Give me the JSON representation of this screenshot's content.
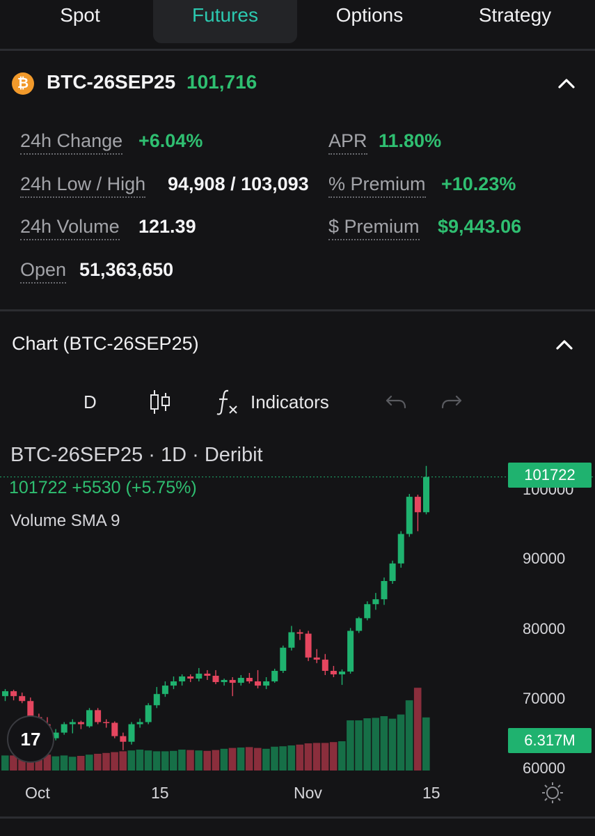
{
  "tabs": [
    {
      "label": "Spot"
    },
    {
      "label": "Futures"
    },
    {
      "label": "Options"
    },
    {
      "label": "Strategy"
    }
  ],
  "instrument": {
    "name": "BTC-26SEP25",
    "price": "101,716",
    "coin_symbol": "₿",
    "stats": {
      "change_label": "24h Change",
      "change_value": "+6.04%",
      "lowhigh_label": "24h Low / High",
      "lowhigh_value": "94,908 / 103,093",
      "volume_label": "24h Volume",
      "volume_value": "121.39",
      "open_label": "Open",
      "open_value": "51,363,650",
      "apr_label": "APR",
      "apr_value": "11.80%",
      "pct_premium_label": "% Premium",
      "pct_premium_value": "+10.23%",
      "usd_premium_label": "$ Premium",
      "usd_premium_value": "$9,443.06"
    }
  },
  "chart_section": {
    "title": "Chart (BTC-26SEP25)",
    "toolbar": {
      "interval": "D",
      "indicators_label": "Indicators"
    },
    "legend_title": "BTC-26SEP25 · 1D · Deribit",
    "legend_values": "101722  +5530 (+5.75%)",
    "legend_volume": "Volume SMA 9",
    "price_tag": "101722",
    "volume_tag": "6.317M",
    "logo_text": "17"
  },
  "colors": {
    "up": "#1fb26f",
    "down": "#e5465f",
    "accent": "#2cc9b0"
  },
  "chart_data": {
    "type": "candlestick",
    "y_ticks": [
      "100000",
      "90000",
      "80000",
      "70000",
      "60000"
    ],
    "x_ticks": [
      "Oct",
      "15",
      "Nov",
      "15"
    ],
    "ylim": [
      59000,
      103500
    ],
    "candles": [
      {
        "o": 70500,
        "h": 71500,
        "l": 69800,
        "c": 71200
      },
      {
        "o": 71200,
        "h": 71400,
        "l": 69900,
        "c": 70500
      },
      {
        "o": 70500,
        "h": 71000,
        "l": 69500,
        "c": 69800
      },
      {
        "o": 69800,
        "h": 70300,
        "l": 67200,
        "c": 67500
      },
      {
        "o": 67500,
        "h": 68000,
        "l": 66200,
        "c": 66500
      },
      {
        "o": 66500,
        "h": 67500,
        "l": 63800,
        "c": 64500
      },
      {
        "o": 64500,
        "h": 65800,
        "l": 64200,
        "c": 65300
      },
      {
        "o": 65300,
        "h": 66800,
        "l": 65000,
        "c": 66500
      },
      {
        "o": 66500,
        "h": 67200,
        "l": 65200,
        "c": 66800
      },
      {
        "o": 66800,
        "h": 67000,
        "l": 65800,
        "c": 66500
      },
      {
        "o": 66200,
        "h": 68800,
        "l": 66000,
        "c": 68500
      },
      {
        "o": 68500,
        "h": 68800,
        "l": 66500,
        "c": 66800
      },
      {
        "o": 66800,
        "h": 67200,
        "l": 66000,
        "c": 66700
      },
      {
        "o": 66700,
        "h": 66900,
        "l": 64500,
        "c": 64800
      },
      {
        "o": 64800,
        "h": 65300,
        "l": 62800,
        "c": 64000
      },
      {
        "o": 64000,
        "h": 66800,
        "l": 63600,
        "c": 66500
      },
      {
        "o": 66500,
        "h": 67300,
        "l": 66000,
        "c": 66800
      },
      {
        "o": 66800,
        "h": 69500,
        "l": 66500,
        "c": 69200
      },
      {
        "o": 69200,
        "h": 71800,
        "l": 68800,
        "c": 70800
      },
      {
        "o": 70800,
        "h": 72600,
        "l": 70400,
        "c": 72000
      },
      {
        "o": 72000,
        "h": 73300,
        "l": 71500,
        "c": 72600
      },
      {
        "o": 72600,
        "h": 73600,
        "l": 72000,
        "c": 73300
      },
      {
        "o": 73300,
        "h": 73600,
        "l": 72500,
        "c": 73000
      },
      {
        "o": 73000,
        "h": 74500,
        "l": 72600,
        "c": 73700
      },
      {
        "o": 73700,
        "h": 74200,
        "l": 72800,
        "c": 73400
      },
      {
        "o": 73400,
        "h": 74200,
        "l": 72200,
        "c": 72500
      },
      {
        "o": 72500,
        "h": 73000,
        "l": 72000,
        "c": 72800
      },
      {
        "o": 72800,
        "h": 73200,
        "l": 70500,
        "c": 72400
      },
      {
        "o": 72400,
        "h": 73500,
        "l": 72000,
        "c": 73100
      },
      {
        "o": 73100,
        "h": 73800,
        "l": 72300,
        "c": 72600
      },
      {
        "o": 72600,
        "h": 74200,
        "l": 71600,
        "c": 72000
      },
      {
        "o": 72000,
        "h": 73200,
        "l": 71500,
        "c": 72600
      },
      {
        "o": 72600,
        "h": 74400,
        "l": 72400,
        "c": 74100
      },
      {
        "o": 74100,
        "h": 77700,
        "l": 73800,
        "c": 77400
      },
      {
        "o": 77400,
        "h": 80500,
        "l": 77000,
        "c": 79600
      },
      {
        "o": 79600,
        "h": 80000,
        "l": 78500,
        "c": 79400
      },
      {
        "o": 79400,
        "h": 79800,
        "l": 75500,
        "c": 76000
      },
      {
        "o": 76000,
        "h": 77200,
        "l": 75200,
        "c": 75700
      },
      {
        "o": 75700,
        "h": 76500,
        "l": 73500,
        "c": 74100
      },
      {
        "o": 74100,
        "h": 74800,
        "l": 73200,
        "c": 73600
      },
      {
        "o": 73600,
        "h": 74300,
        "l": 72100,
        "c": 74000
      },
      {
        "o": 74000,
        "h": 80200,
        "l": 73700,
        "c": 79800
      },
      {
        "o": 79800,
        "h": 81800,
        "l": 79500,
        "c": 81600
      },
      {
        "o": 81600,
        "h": 84000,
        "l": 81300,
        "c": 83600
      },
      {
        "o": 83600,
        "h": 85200,
        "l": 82800,
        "c": 84300
      },
      {
        "o": 84300,
        "h": 87400,
        "l": 83500,
        "c": 86900
      },
      {
        "o": 86900,
        "h": 89800,
        "l": 86500,
        "c": 89400
      },
      {
        "o": 89400,
        "h": 94000,
        "l": 88800,
        "c": 93600
      },
      {
        "o": 93600,
        "h": 99300,
        "l": 93200,
        "c": 98900
      },
      {
        "o": 98900,
        "h": 99200,
        "l": 94000,
        "c": 96700
      },
      {
        "o": 96700,
        "h": 103300,
        "l": 96400,
        "c": 101722
      }
    ],
    "volumes": [
      36,
      36,
      38,
      36,
      36,
      38,
      34,
      36,
      33,
      35,
      38,
      40,
      42,
      44,
      46,
      48,
      50,
      48,
      46,
      46,
      47,
      50,
      49,
      48,
      47,
      49,
      52,
      54,
      55,
      56,
      54,
      52,
      57,
      58,
      60,
      62,
      65,
      66,
      66,
      68,
      70,
      120,
      120,
      125,
      126,
      130,
      124,
      134,
      168,
      198,
      127
    ]
  }
}
